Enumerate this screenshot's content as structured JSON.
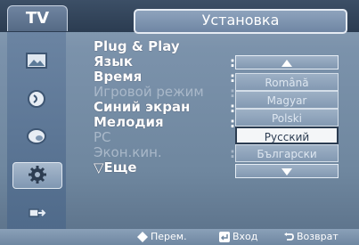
{
  "header": {
    "tv_tab": "TV",
    "section_title": "Установка"
  },
  "sidebar": {
    "icons": [
      "picture-icon",
      "sound-icon",
      "channel-icon",
      "setup-icon",
      "input-icon"
    ],
    "active_index": 3
  },
  "menu": {
    "items": [
      {
        "label": "Plug & Play",
        "enabled": true
      },
      {
        "label": "Язык",
        "enabled": true,
        "has_colon": true
      },
      {
        "label": "Время",
        "enabled": true,
        "has_colon": true
      },
      {
        "label": "Игровой режим",
        "enabled": false,
        "has_colon": true
      },
      {
        "label": "Синий экран",
        "enabled": true,
        "has_colon": true
      },
      {
        "label": "Мелодия",
        "enabled": true,
        "has_colon": true
      },
      {
        "label": "PC",
        "enabled": false
      },
      {
        "label": "Экон.кин.",
        "enabled": false,
        "has_colon": true
      },
      {
        "label": "▽Еще",
        "enabled": true
      }
    ]
  },
  "language_dropdown": {
    "options": [
      "Română",
      "Magyar",
      "Polski",
      "Русский",
      "Български"
    ],
    "selected": "Русский"
  },
  "footer": {
    "move_label": "Перем.",
    "enter_label": "Вход",
    "return_label": "Возврат"
  },
  "colors": {
    "background": "#7b92ab",
    "header": "#2b3c51",
    "selected_option_bg": "#f4f6f8",
    "text": "#ffffff"
  }
}
